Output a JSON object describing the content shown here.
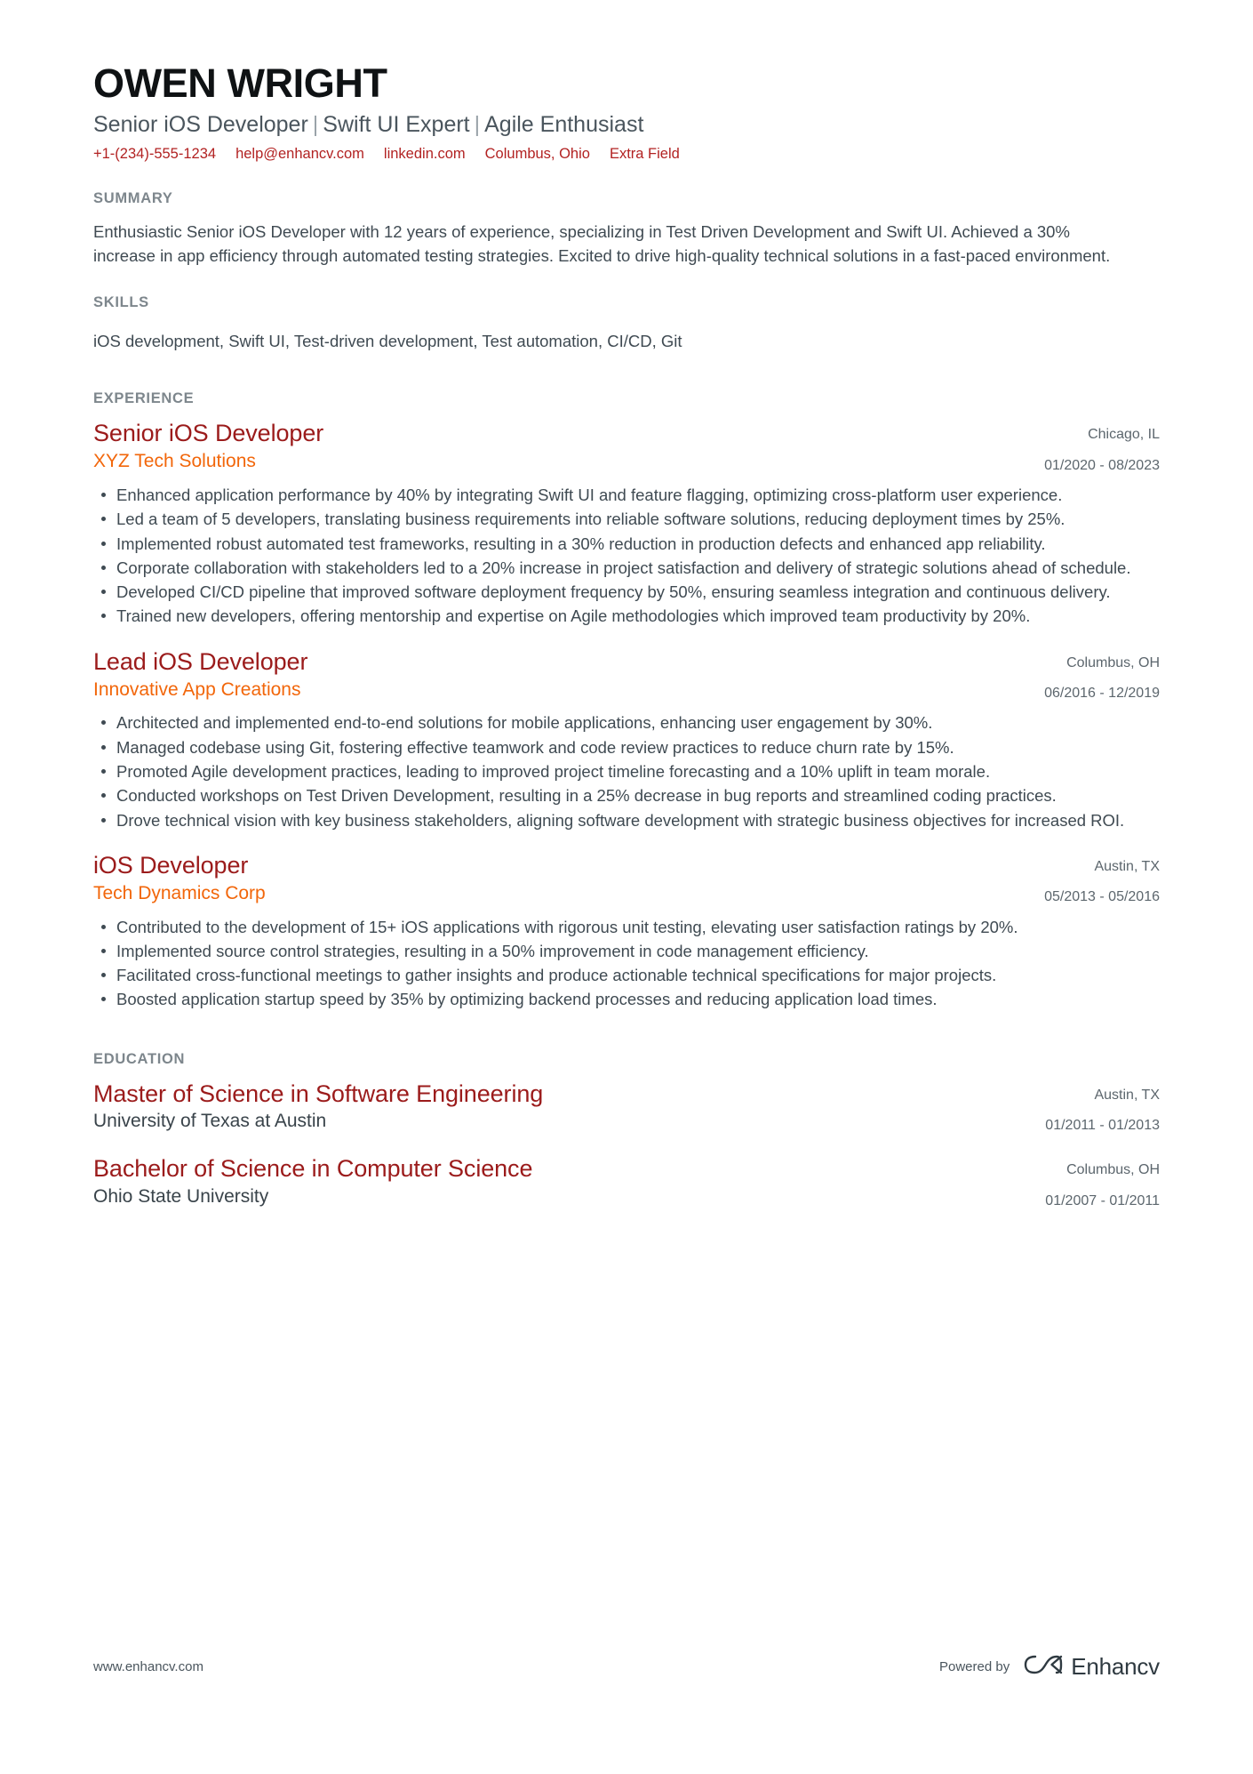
{
  "header": {
    "name": "OWEN WRIGHT",
    "headline_parts": [
      "Senior iOS Developer",
      "Swift UI Expert",
      "Agile Enthusiast"
    ],
    "headline_separator": "|",
    "contacts": [
      "+1-(234)-555-1234",
      "help@enhancv.com",
      "linkedin.com",
      "Columbus, Ohio",
      "Extra Field"
    ]
  },
  "summary": {
    "title": "SUMMARY",
    "text": "Enthusiastic Senior iOS Developer with 12 years of experience, specializing in Test Driven Development and Swift UI. Achieved a 30% increase in app efficiency through automated testing strategies. Excited to drive high-quality technical solutions in a fast-paced environment."
  },
  "skills": {
    "title": "SKILLS",
    "text": "iOS development, Swift UI, Test-driven development, Test automation, CI/CD, Git"
  },
  "experience": {
    "title": "EXPERIENCE",
    "entries": [
      {
        "title": "Senior iOS Developer",
        "company": "XYZ Tech Solutions",
        "location": "Chicago, IL",
        "date": "01/2020 - 08/2023",
        "bullets": [
          "Enhanced application performance by 40% by integrating Swift UI and feature flagging, optimizing cross-platform user experience.",
          "Led a team of 5 developers, translating business requirements into reliable software solutions, reducing deployment times by 25%.",
          "Implemented robust automated test frameworks, resulting in a 30% reduction in production defects and enhanced app reliability.",
          "Corporate collaboration with stakeholders led to a 20% increase in project satisfaction and delivery of strategic solutions ahead of schedule.",
          "Developed CI/CD pipeline that improved software deployment frequency by 50%, ensuring seamless integration and continuous delivery.",
          "Trained new developers, offering mentorship and expertise on Agile methodologies which improved team productivity by 20%."
        ]
      },
      {
        "title": "Lead iOS Developer",
        "company": "Innovative App Creations",
        "location": "Columbus, OH",
        "date": "06/2016 - 12/2019",
        "bullets": [
          "Architected and implemented end-to-end solutions for mobile applications, enhancing user engagement by 30%.",
          "Managed codebase using Git, fostering effective teamwork and code review practices to reduce churn rate by 15%.",
          "Promoted Agile development practices, leading to improved project timeline forecasting and a 10% uplift in team morale.",
          "Conducted workshops on Test Driven Development, resulting in a 25% decrease in bug reports and streamlined coding practices.",
          "Drove technical vision with key business stakeholders, aligning software development with strategic business objectives for increased ROI."
        ]
      },
      {
        "title": "iOS Developer",
        "company": "Tech Dynamics Corp",
        "location": "Austin, TX",
        "date": "05/2013 - 05/2016",
        "bullets": [
          "Contributed to the development of 15+ iOS applications with rigorous unit testing, elevating user satisfaction ratings by 20%.",
          "Implemented source control strategies, resulting in a 50% improvement in code management efficiency.",
          "Facilitated cross-functional meetings to gather insights and produce actionable technical specifications for major projects.",
          "Boosted application startup speed by 35% by optimizing backend processes and reducing application load times."
        ]
      }
    ]
  },
  "education": {
    "title": "EDUCATION",
    "entries": [
      {
        "degree": "Master of Science in Software Engineering",
        "school": "University of Texas at Austin",
        "location": "Austin, TX",
        "date": "01/2011 - 01/2013"
      },
      {
        "degree": "Bachelor of Science in Computer Science",
        "school": "Ohio State University",
        "location": "Columbus, OH",
        "date": "01/2007 - 01/2011"
      }
    ]
  },
  "footer": {
    "url": "www.enhancv.com",
    "powered_by": "Powered by",
    "brand_name": "Enhancv",
    "brand_icon": "enhancv-infinity-logo-icon"
  },
  "colors": {
    "name": "#0f1214",
    "headline": "#4a555d",
    "contact_link": "#b22222",
    "section_title": "#7d868c",
    "entry_title": "#9b1b1b",
    "company": "#f2660a",
    "body_text": "#3f4a52",
    "meta_text": "#5c666d",
    "background": "#ffffff"
  }
}
